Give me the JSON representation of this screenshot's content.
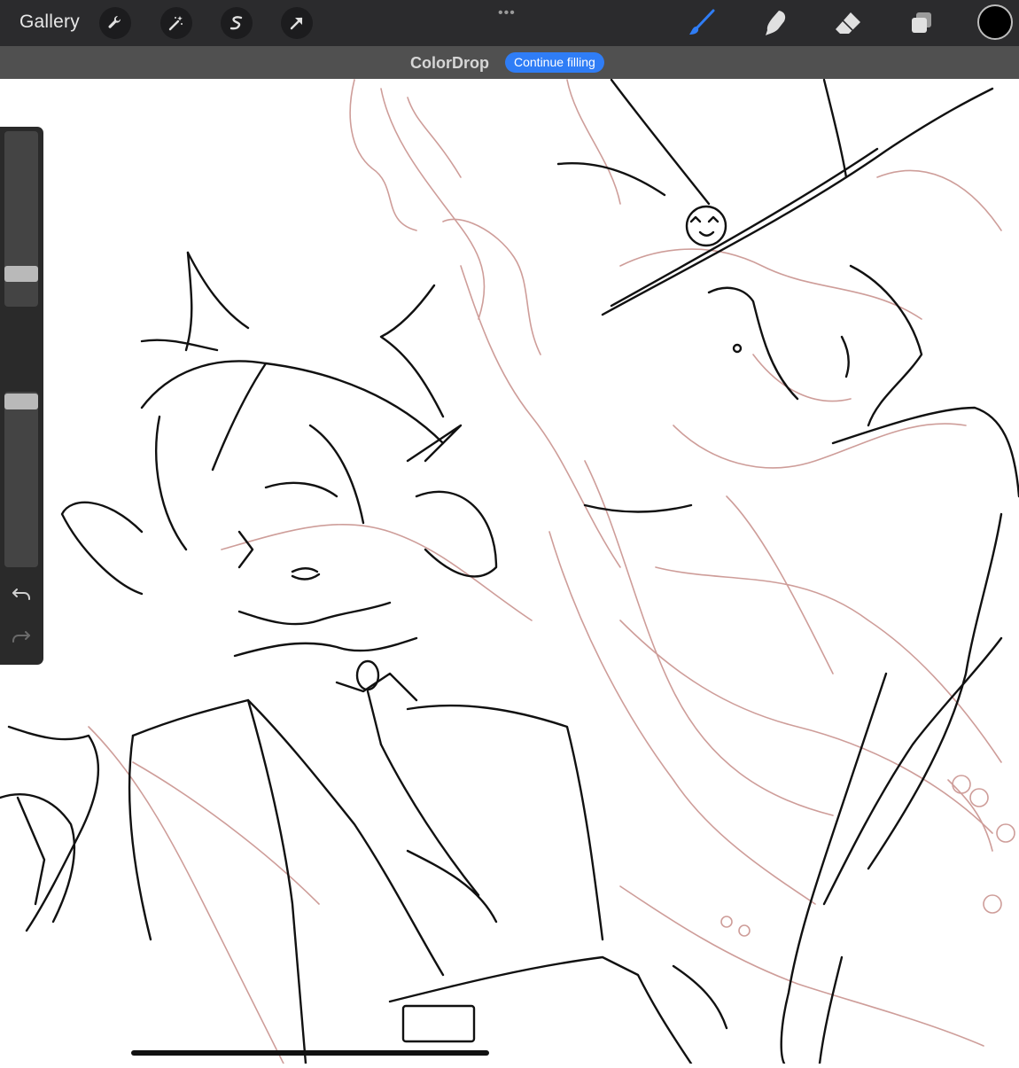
{
  "toolbar": {
    "gallery_label": "Gallery",
    "more_dots": "•••",
    "left_tools": [
      {
        "name": "actions",
        "icon": "wrench-icon"
      },
      {
        "name": "adjustments",
        "icon": "magic-wand-icon"
      },
      {
        "name": "selection",
        "icon": "selection-s-icon"
      },
      {
        "name": "transform",
        "icon": "arrow-cursor-icon"
      }
    ],
    "right_tools": [
      {
        "name": "brush",
        "icon": "brush-icon",
        "active": true
      },
      {
        "name": "smudge",
        "icon": "smudge-finger-icon"
      },
      {
        "name": "eraser",
        "icon": "eraser-icon"
      },
      {
        "name": "layers",
        "icon": "layers-icon"
      }
    ],
    "active_color": "#000000",
    "accent_color": "#2f7df6"
  },
  "colordrop": {
    "title": "ColorDrop",
    "action_label": "Continue filling"
  },
  "sidebar": {
    "brush_size_level": 0.18,
    "opacity_level": 0.6,
    "modify_icon": "square-modify-icon",
    "undo_icon": "undo-icon",
    "redo_icon": "redo-icon"
  },
  "canvas": {
    "content": "sketch-artwork",
    "ink_colors": [
      "#111111",
      "#c9938f"
    ]
  }
}
